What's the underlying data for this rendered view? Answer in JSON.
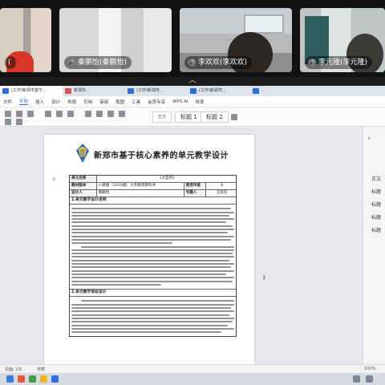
{
  "participants": [
    {
      "name": "(",
      "id": "p1"
    },
    {
      "name": "秦鹏怡(秦鹏怡)",
      "id": "p2"
    },
    {
      "name": "李欢欢(李欢欢)",
      "id": "p3"
    },
    {
      "name": "李元隆(李元隆)",
      "id": "p4"
    }
  ],
  "collapse_glyph": "︿",
  "tabs": [
    {
      "label": "(工作)新郑市基于..."
    },
    {
      "label": "新郑市..."
    },
    {
      "label": "(工作)新郑市..."
    },
    {
      "label": "(工作)新郑市..."
    },
    {
      "label": "..."
    }
  ],
  "menu": [
    "文件",
    "开始",
    "插入",
    "设计",
    "布局",
    "引用",
    "审阅",
    "视图",
    "工具",
    "会员专享",
    "WPS AI",
    "效率"
  ],
  "menu_active_index": 1,
  "ribbon_styles": [
    "正文",
    "标题 1",
    "标题 2"
  ],
  "document": {
    "title": "新郑市基于核心素养的单元教学设计",
    "row_number": "①",
    "form_rows": [
      [
        "单元名称",
        "《大自然》",
        "",
        ""
      ],
      [
        "教材版本",
        "人教版（2019版）义务教育教科书",
        "使用年级",
        "8"
      ],
      [
        "设计人",
        "秦鹏怡",
        "专题人",
        "王欢欢"
      ]
    ],
    "section1": "1.单元教学设计说明",
    "section2": "2.单元教学目标设计"
  },
  "right_panel": [
    "正文",
    "标题",
    "标题",
    "标题",
    "标题"
  ],
  "status_bar": {
    "left": "页面: 1/5",
    "words": "字数",
    "zoom": "100%"
  },
  "accent_color": "#2b6ed9"
}
